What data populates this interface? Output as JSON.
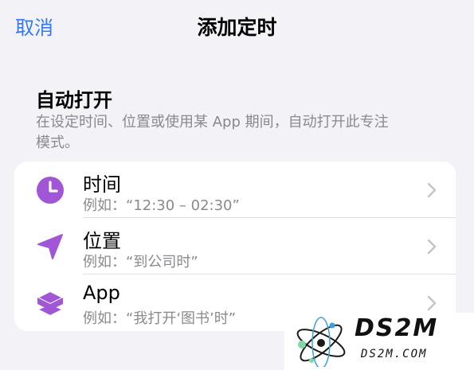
{
  "nav": {
    "cancel_label": "取消",
    "title": "添加定时"
  },
  "section": {
    "title": "自动打开",
    "description": "在设定时间、位置或使用某 App 期间，自动打开此专注模式。"
  },
  "options": [
    {
      "label": "时间",
      "subtitle": "例如：“12:30 – 02:30”",
      "icon": "clock-icon"
    },
    {
      "label": "位置",
      "subtitle": "例如：“到公司时”",
      "icon": "location-arrow-icon"
    },
    {
      "label": "App",
      "subtitle": "例如：“我打开‘图书’时”",
      "icon": "app-stack-icon"
    }
  ],
  "watermark": {
    "text": "DS2M",
    "subtext": "DS2M.COM"
  },
  "colors": {
    "accent_blue": "#3478f6",
    "icon_purple": "#a156d6",
    "background": "#f2f2f7",
    "secondary_text": "#8a8a8e"
  }
}
